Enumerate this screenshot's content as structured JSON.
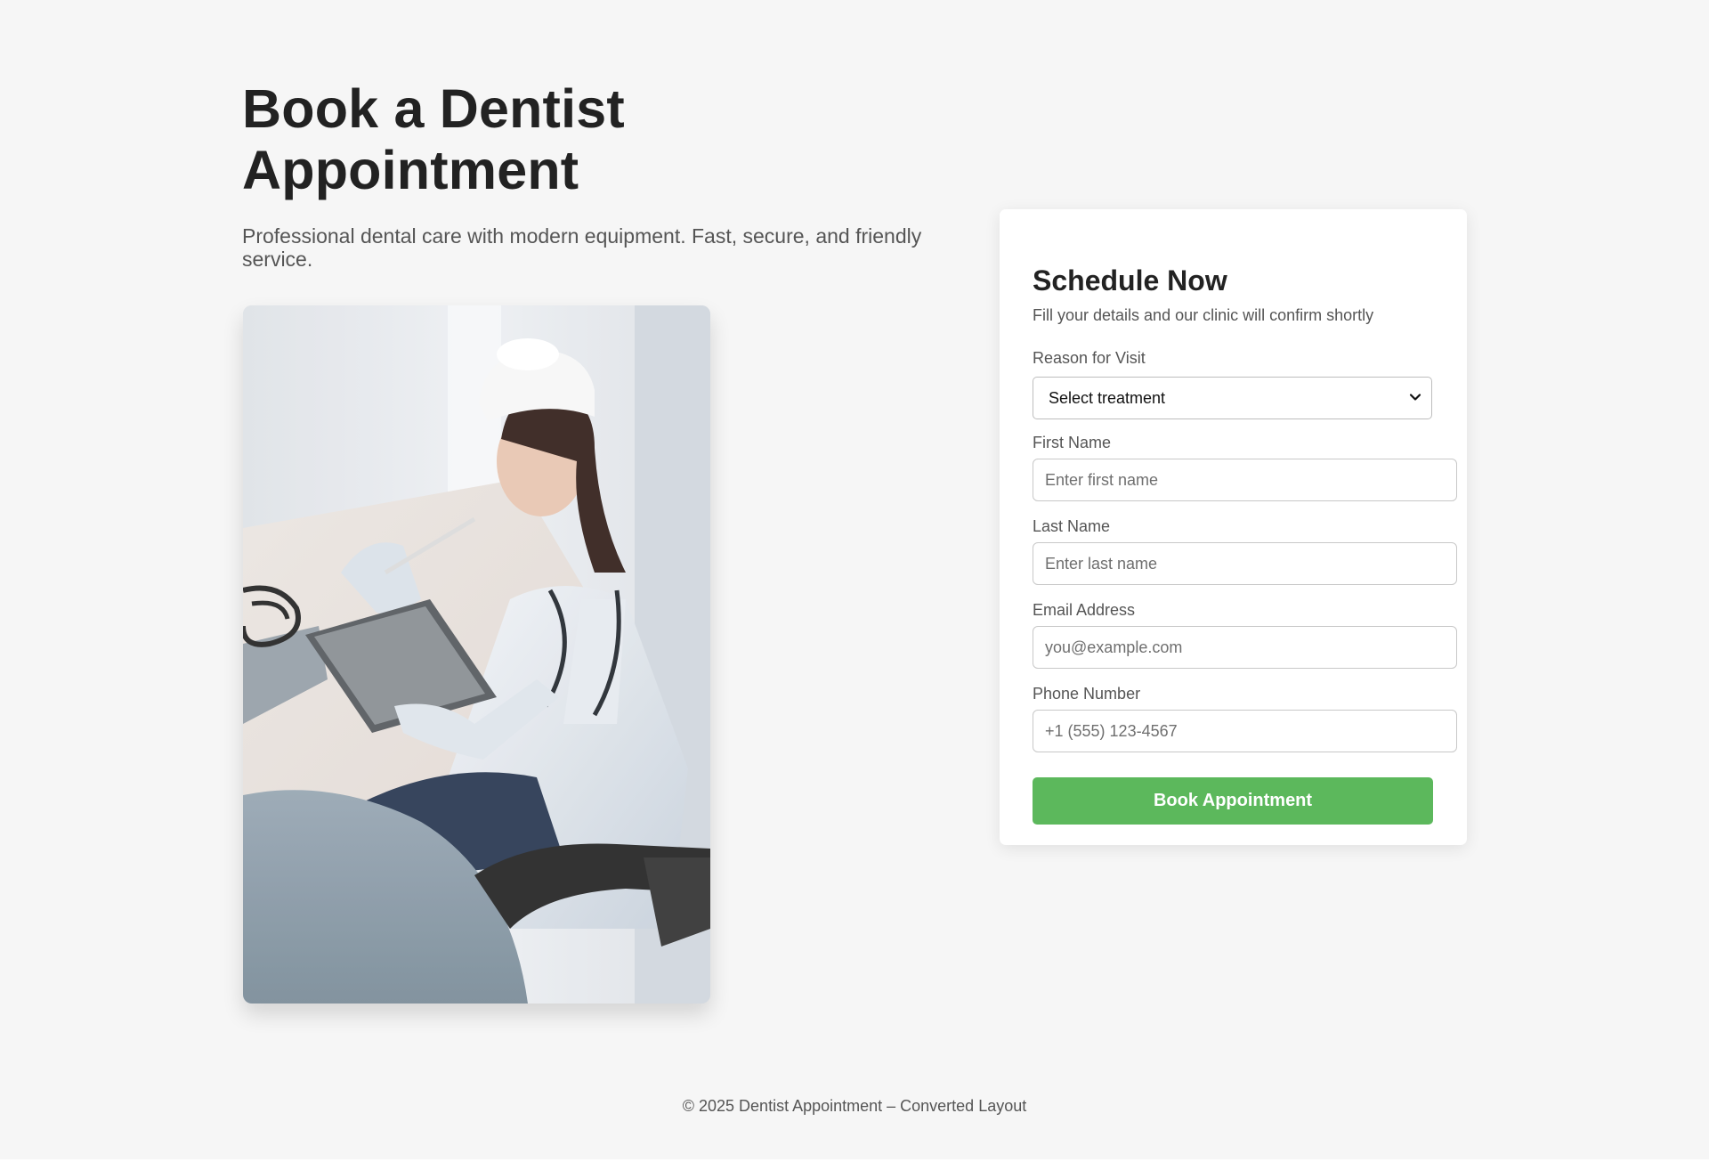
{
  "hero": {
    "title_line1": "Book a Dentist",
    "title_line2": "Appointment",
    "subtitle": "Professional dental care with modern equipment. Fast, secure, and friendly service."
  },
  "photo": {
    "subject": "dentist-photo"
  },
  "form": {
    "title": "Schedule Now",
    "subtitle": "Fill your details and our clinic will confirm shortly",
    "reason": {
      "label": "Reason for Visit",
      "selected": "Select treatment"
    },
    "first_name": {
      "label": "First Name",
      "placeholder": "Enter first name"
    },
    "last_name": {
      "label": "Last Name",
      "placeholder": "Enter last name"
    },
    "email": {
      "label": "Email Address",
      "placeholder": "you@example.com"
    },
    "phone": {
      "label": "Phone Number",
      "placeholder": "+1 (555) 123-4567"
    },
    "submit_label": "Book Appointment"
  },
  "footer": {
    "text": "© 2025 Dentist Appointment – Converted Layout"
  },
  "colors": {
    "background": "#f6f6f6",
    "accent": "#5cb85c",
    "text": "#222222",
    "muted": "#555555"
  },
  "icons": {
    "select_arrow": "chevron-down-icon"
  }
}
